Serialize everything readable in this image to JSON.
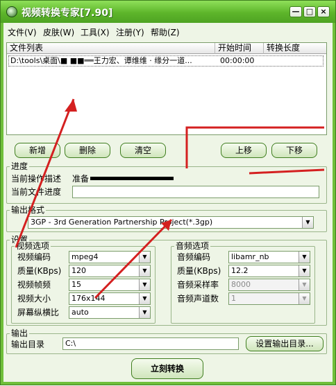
{
  "window": {
    "title": "视频转换专家[7.90]",
    "minimize": "—",
    "maximize": "□",
    "close": "×"
  },
  "menu": {
    "file": "文件(V)",
    "skin": "皮肤(W)",
    "tools": "工具(X)",
    "register": "注册(Y)",
    "help": "帮助(Z)"
  },
  "filelist": {
    "columns": [
      "文件列表",
      "开始时间",
      "转换长度"
    ],
    "rows": [
      {
        "file": "D:\\tools\\桌面\\■  ■■══王力宏、谭维维 · 缘分一道...",
        "start": "00:00:00",
        "length": ""
      }
    ]
  },
  "buttons": {
    "add": "新增",
    "delete": "删除",
    "clear": "清空",
    "move_up": "上移",
    "move_down": "下移",
    "convert": "立刻转换",
    "set_output_dir": "设置输出目录..."
  },
  "progress": {
    "group": "进度",
    "current_op_label": "当前操作描述",
    "current_op_value": "准备",
    "current_file_label": "当前文件进度"
  },
  "output_format": {
    "group": "输出格式",
    "value": "3GP - 3rd Generation Partnership Project(*.3gp)"
  },
  "settings": {
    "group": "设置",
    "video": {
      "group": "视频选项",
      "codec_label": "视频编码",
      "codec": "mpeg4",
      "quality_label": "质量(KBps)",
      "quality": "120",
      "fps_label": "视频帧频",
      "fps": "15",
      "size_label": "视频大小",
      "size": "176x144",
      "aspect_label": "屏幕纵横比",
      "aspect": "auto"
    },
    "audio": {
      "group": "音频选项",
      "codec_label": "音频编码",
      "codec": "libamr_nb",
      "quality_label": "质量(KBps)",
      "quality": "12.2",
      "rate_label": "音频采样率",
      "rate": "8000",
      "channels_label": "音频声道数",
      "channels": "1"
    }
  },
  "output": {
    "group": "输出",
    "dir_label": "输出目录",
    "dir_value": "C:\\"
  },
  "colors": {
    "frame": "#6fbf3a",
    "client": "#eef5e6",
    "annotation": "#d42020"
  }
}
